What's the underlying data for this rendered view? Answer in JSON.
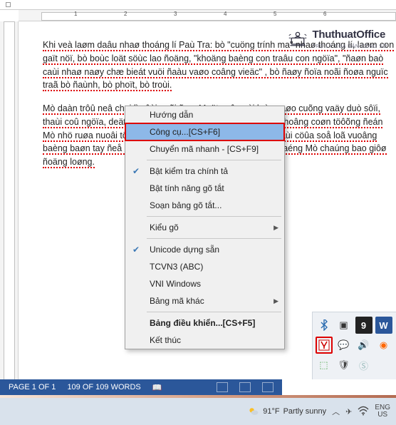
{
  "ruler": {
    "marks": [
      "1",
      "2",
      "3",
      "4",
      "5",
      "6"
    ]
  },
  "logo": {
    "name": "ThuthuatOffice",
    "tag": "TRỢ LÝ CỦA DÂN CÔNG SỞ"
  },
  "doc": {
    "p1": "Khi veà laøm daâu nhaø thoáng lí Paù Tra: bò \"cuöng trính ma\" nhaø thoáng lí, laøm con gaït nöï, bò boùc loät söùc lao ñoäng, \"khoäng baèng con traâu con ngöïa\", \"ñaøn baò caùi nhaø naøy chæ bieát vuöi ñaàu vaøo coâng vieäc\" , bò ñaøy ñoïa noãi ñoøa nguïc traã bò ñaùnh, bò phoït, bò troùi.",
    "p2": "Mò daàn trôû neâ chai lì vôùi noãi ñau: Moät coâ gaùi luùc naøo cuõng vaäy duò sôïi, thaùi coû ngöïa, deät vaûi, cheû cuùi, ñi coäng, ñi nöông,... Khoâng coøn töôõng ñeán Mò nhö ruøa nuoâi töông xoù cöûa , thôøi gian \"loãng vôùi caùi cöûa soå loã vuoâng baèng baøn tay ñeå ngoù ra ngoaøi trôøi\" , ñoái soâng hay naéng Mò chaúng bao giôø ñoäng loøng."
  },
  "menu": {
    "guide": "Hướng dẫn",
    "tools": "Công cụ...[CS+F6]",
    "quickconv": "Chuyển mã nhanh - [CS+F9]",
    "spell": "Bật kiểm tra chính tả",
    "shortcut": "Bật tính năng gõ tắt",
    "shortedit": "Soạn bảng gõ tắt...",
    "style": "Kiểu gõ",
    "unicode": "Unicode dựng sẵn",
    "tcvn": "TCVN3 (ABC)",
    "vni": "VNI Windows",
    "othertable": "Bảng mã khác",
    "ctrlpanel": "Bảng điều khiển...[CS+F5]",
    "exit": "Kết thúc"
  },
  "status": {
    "page": "PAGE 1 OF 1",
    "words": "109 OF 109 WORDS"
  },
  "tray": {
    "icons": [
      "bluetooth",
      "video",
      "nine",
      "w",
      "unikey",
      "chat",
      "speaker",
      "avast",
      "safe",
      "shield",
      "skype",
      ""
    ]
  },
  "taskbar": {
    "temp": "91°F",
    "cond": "Partly sunny",
    "lang1": "ENG",
    "lang2": "US"
  }
}
